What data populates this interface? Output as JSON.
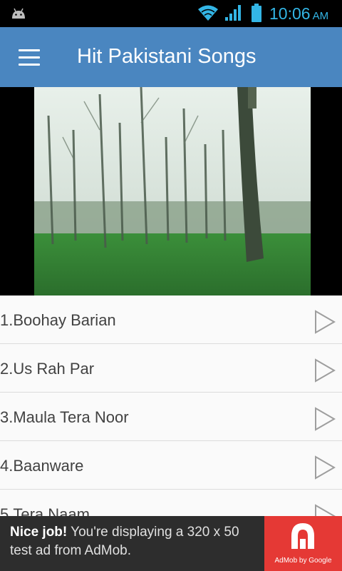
{
  "status_bar": {
    "time": "10:06",
    "ampm": "AM",
    "icons": [
      "android-icon",
      "wifi-icon",
      "signal-icon",
      "battery-icon"
    ]
  },
  "app_bar": {
    "title": "Hit Pakistani Songs",
    "menu_icon": "hamburger-menu-icon"
  },
  "video": {
    "description_icon": "video-thumbnail"
  },
  "songs": [
    {
      "title": "1.Boohay Barian"
    },
    {
      "title": "2.Us Rah Par"
    },
    {
      "title": "3.Maula Tera Noor"
    },
    {
      "title": "4.Baanware"
    },
    {
      "title": "5.Tera Naam"
    }
  ],
  "ad": {
    "headline": "Nice job!",
    "body": " You're displaying a 320 x 50 test ad from AdMob.",
    "brand": "AdMob by Google"
  },
  "colors": {
    "app_bar": "#4a86c0",
    "status_accent": "#33b5e5",
    "ad_background": "#2d2d2d",
    "ad_logo_background": "#e53935"
  }
}
